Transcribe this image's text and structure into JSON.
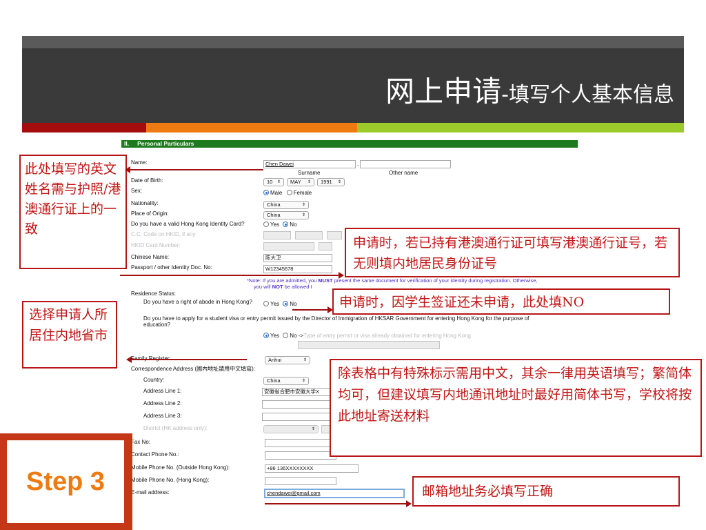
{
  "header": {
    "title_big": "网上申请",
    "title_small": "-填写个人基本信息"
  },
  "section": {
    "number": "II.",
    "title": "Personal Particulars"
  },
  "form": {
    "name_label": "Name:",
    "surname_value": "Chen Dawei",
    "name_comma": ",",
    "other_name_value": "",
    "surname_caption": "Surname",
    "other_name_caption": "Other name",
    "dob_label": "Date of Birth:",
    "dob_day": "10",
    "dob_month": "MAY",
    "dob_year": "1991",
    "sex_label": "Sex:",
    "sex_male": "Male",
    "sex_female": "Female",
    "nationality_label": "Nationality:",
    "nationality_value": "China",
    "origin_label": "Place of Origin:",
    "origin_value": "China",
    "hkid_question": "Do you have a valid Hong Kong Identity Card?",
    "yes": "Yes",
    "no": "No",
    "cc_code_label": "C.C. Code on HKID, if any:",
    "hkid_number_label": "HKID Card Number:",
    "chinese_name_label": "Chinese Name:",
    "chinese_name_value": "陈大卫",
    "passport_label": "Passport / other Identity Doc. No:",
    "passport_value": "W12345678",
    "note_line1_a": "*Note: If you are admitted, you ",
    "note_line1_must": "MUST",
    "note_line1_b": " present the same document for verification of your identity during registration. Otherwise,",
    "note_line2_a": "you will ",
    "note_line2_not": "NOT",
    "note_line2_b": " be allowed t",
    "residence_label": "Residence Status:",
    "abode_question": "Do you have a right of abode in Hong Kong?",
    "visa_question_line1": "Do you have to apply for a student visa or entry permit issued by the Director of Immigration of HKSAR Government for entering Hong Kong for the purpose of",
    "visa_question_line2": "education?",
    "visa_arrow": "->",
    "visa_type_placeholder": "Type of entry permit or visa already obtained for entering Hong Kong",
    "family_register_label": "Family Register:",
    "family_register_value": "Anhui",
    "corr_address_label": "Correspondence Address (國內地址請用中文填寫):",
    "country_label": "Country:",
    "country_value": "China",
    "address1_label": "Address Line 1:",
    "address1_value": "安徽省合肥市安徽大学X",
    "address2_label": "Address Line 2:",
    "address3_label": "Address Line 3:",
    "district_label": "District (HK address only):",
    "fax_label": "Fax No:",
    "contact_phone_label": "Contact Phone No.:",
    "mobile_outside_label": "Mobile Phone No. (Outside Hong Kong):",
    "mobile_outside_value": "+86 136XXXXXXXX",
    "mobile_hk_label": "Mobile Phone No. (Hong Kong):",
    "email_label": "E-mail address:",
    "email_value": "chendawei@gmail.com"
  },
  "annotations": {
    "name_note": "此处填写的英文姓名需与护照/港澳通行证上的一致",
    "passport_note": "申请时，若已持有港澳通行证可填写港澳通行证号，若无则填内地居民身份证号",
    "visa_note": "申请时，因学生签证还未申请，此处填NO",
    "province_note": "选择申请人所居住内地省市",
    "language_note": "除表格中有特殊标示需用中文，其余一律用英语填写；繁简体均可，但建议填写内地通讯地址时最好用简体书写，学校将按此地址寄送材料",
    "email_note": "邮箱地址务必填写正确"
  },
  "step_badge": "Step 3",
  "colors": {
    "header_dark": "#3a3a3a",
    "accent_red": "#a40d0d",
    "accent_orange": "#f07a12",
    "accent_green": "#9bcb2a",
    "annotation_red": "#c11515",
    "section_green": "#1e7a1e"
  }
}
